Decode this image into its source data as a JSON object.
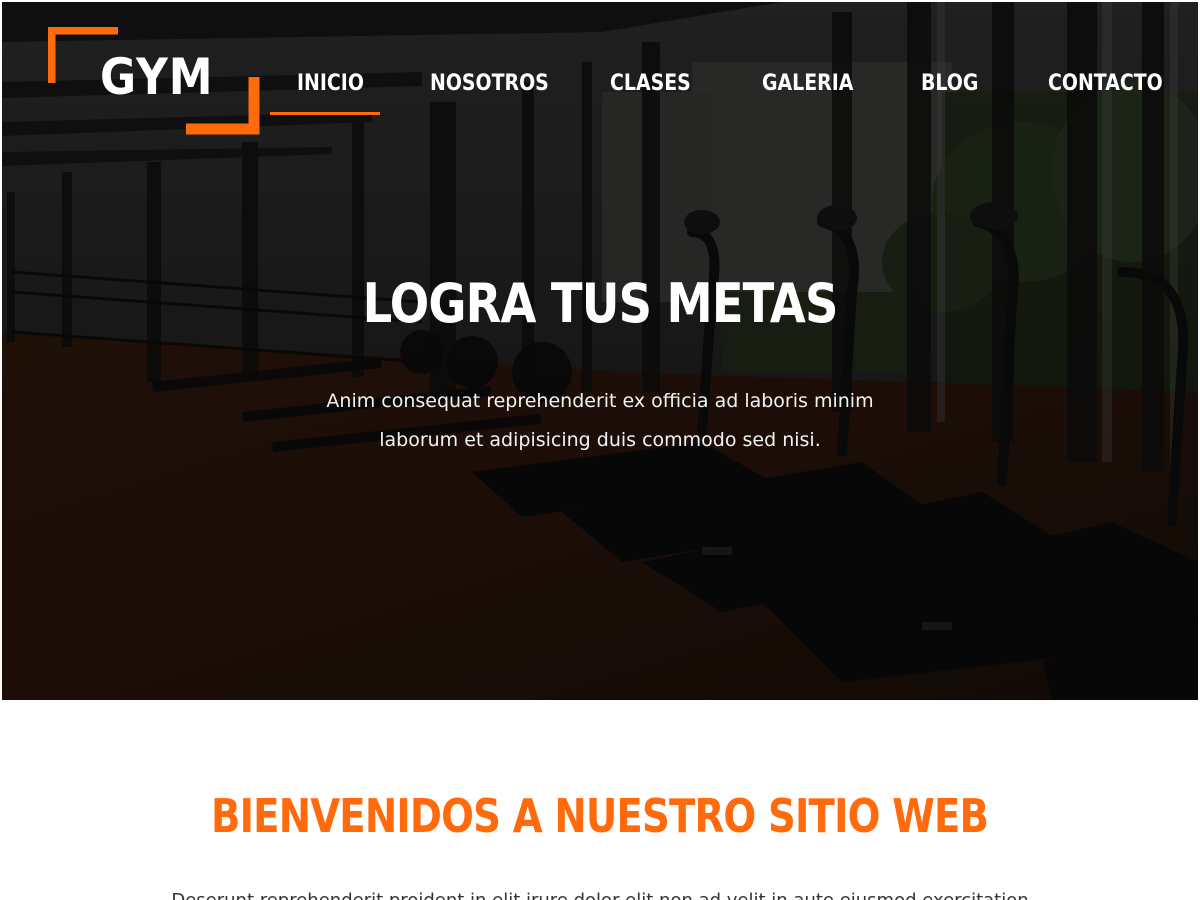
{
  "logo": {
    "text": "GYM",
    "bracket_color": "#ff6a0d"
  },
  "nav": {
    "items": [
      {
        "label": "INICIO",
        "active": true
      },
      {
        "label": "NOSOTROS",
        "active": false
      },
      {
        "label": "CLASES",
        "active": false
      },
      {
        "label": "GALERIA",
        "active": false
      },
      {
        "label": "BLOG",
        "active": false
      },
      {
        "label": "CONTACTO",
        "active": false
      }
    ],
    "active_underline_color": "#ff6a0d"
  },
  "hero": {
    "title": "LOGRA TUS METAS",
    "subtitle": "Anim consequat reprehenderit ex officia ad laboris minim laborum et adipisicing duis commodo sed nisi."
  },
  "welcome": {
    "title": "BIENVENIDOS A NUESTRO SITIO WEB",
    "body": "Deserunt reprehenderit proident in elit irure dolor elit non ad velit in aute eiusmod exercitation",
    "title_color": "#ff6a0d"
  }
}
